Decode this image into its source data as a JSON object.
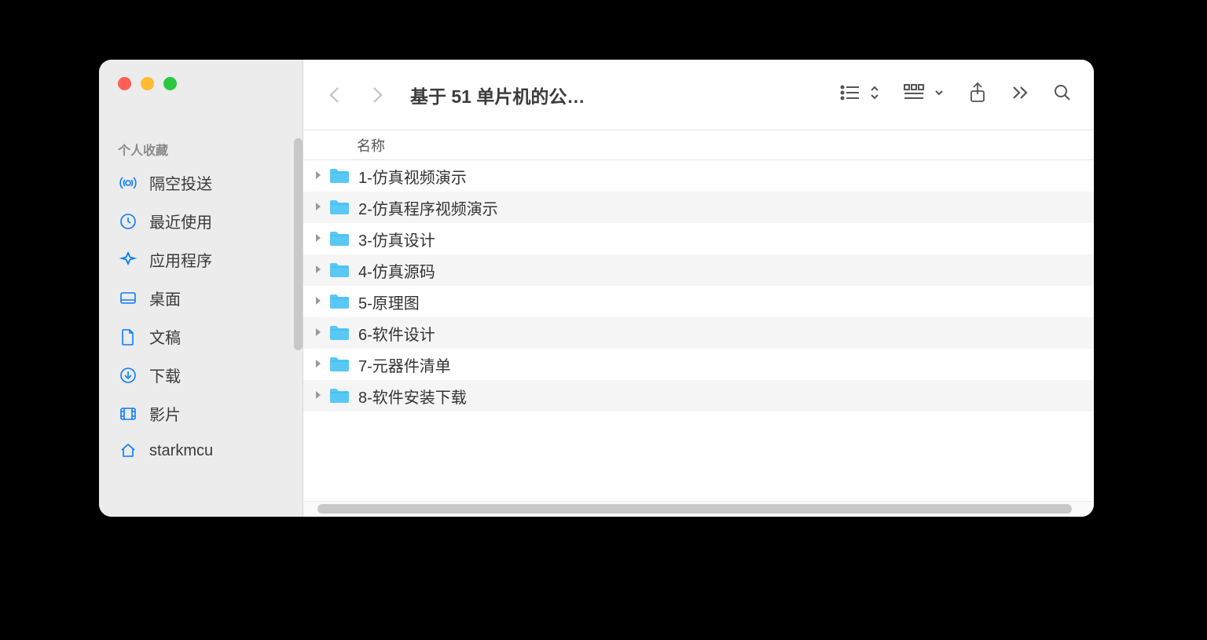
{
  "sidebar": {
    "section_label": "个人收藏",
    "items": [
      {
        "icon": "airdrop",
        "label": "隔空投送"
      },
      {
        "icon": "clock",
        "label": "最近使用"
      },
      {
        "icon": "apps",
        "label": "应用程序"
      },
      {
        "icon": "desktop",
        "label": "桌面"
      },
      {
        "icon": "doc",
        "label": "文稿"
      },
      {
        "icon": "download",
        "label": "下载"
      },
      {
        "icon": "film",
        "label": "影片"
      },
      {
        "icon": "home",
        "label": "starkmcu"
      }
    ]
  },
  "toolbar": {
    "title": "基于 51 单片机的公…"
  },
  "columns": {
    "name": "名称"
  },
  "rows": [
    {
      "label": "1-仿真视频演示"
    },
    {
      "label": "2-仿真程序视频演示"
    },
    {
      "label": "3-仿真设计"
    },
    {
      "label": "4-仿真源码"
    },
    {
      "label": "5-原理图"
    },
    {
      "label": "6-软件设计"
    },
    {
      "label": "7-元器件清单"
    },
    {
      "label": "8-软件安装下载"
    }
  ]
}
